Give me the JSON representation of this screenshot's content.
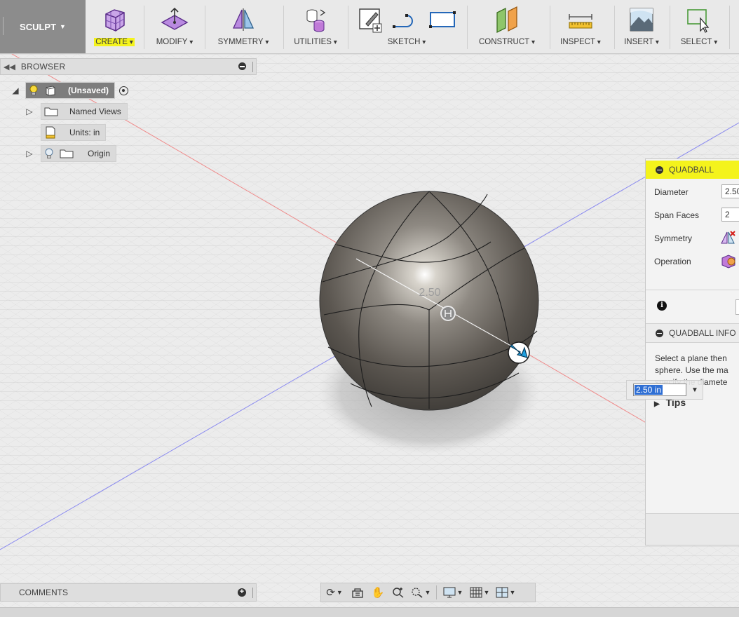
{
  "toolbar": {
    "workspace": "SCULPT",
    "tools": {
      "create": "CREATE",
      "modify": "MODIFY",
      "symmetry": "SYMMETRY",
      "utilities": "UTILITIES",
      "sketch": "SKETCH",
      "construct": "CONSTRUCT",
      "inspect": "INSPECT",
      "insert": "INSERT",
      "select": "SELECT"
    },
    "highlight_color": "#f4f31c"
  },
  "browser": {
    "title": "BROWSER",
    "root": "(Unsaved)",
    "items": {
      "named_views": "Named Views",
      "units": "Units: in",
      "origin": "Origin"
    }
  },
  "viewport": {
    "dimension_label": "2.50"
  },
  "quadball": {
    "title": "QUADBALL",
    "diameter_label": "Diameter",
    "diameter_value": "2.50",
    "span_faces_label": "Span Faces",
    "span_faces_value": "2",
    "symmetry_label": "Symmetry",
    "operation_label": "Operation",
    "info_title": "QUADBALL INFO",
    "description": [
      "Select a plane then",
      "sphere.  Use the ma",
      "specify the diamete"
    ],
    "tips": "Tips"
  },
  "dimension_input": {
    "value": "2.50 in"
  },
  "comments": {
    "title": "COMMENTS"
  }
}
